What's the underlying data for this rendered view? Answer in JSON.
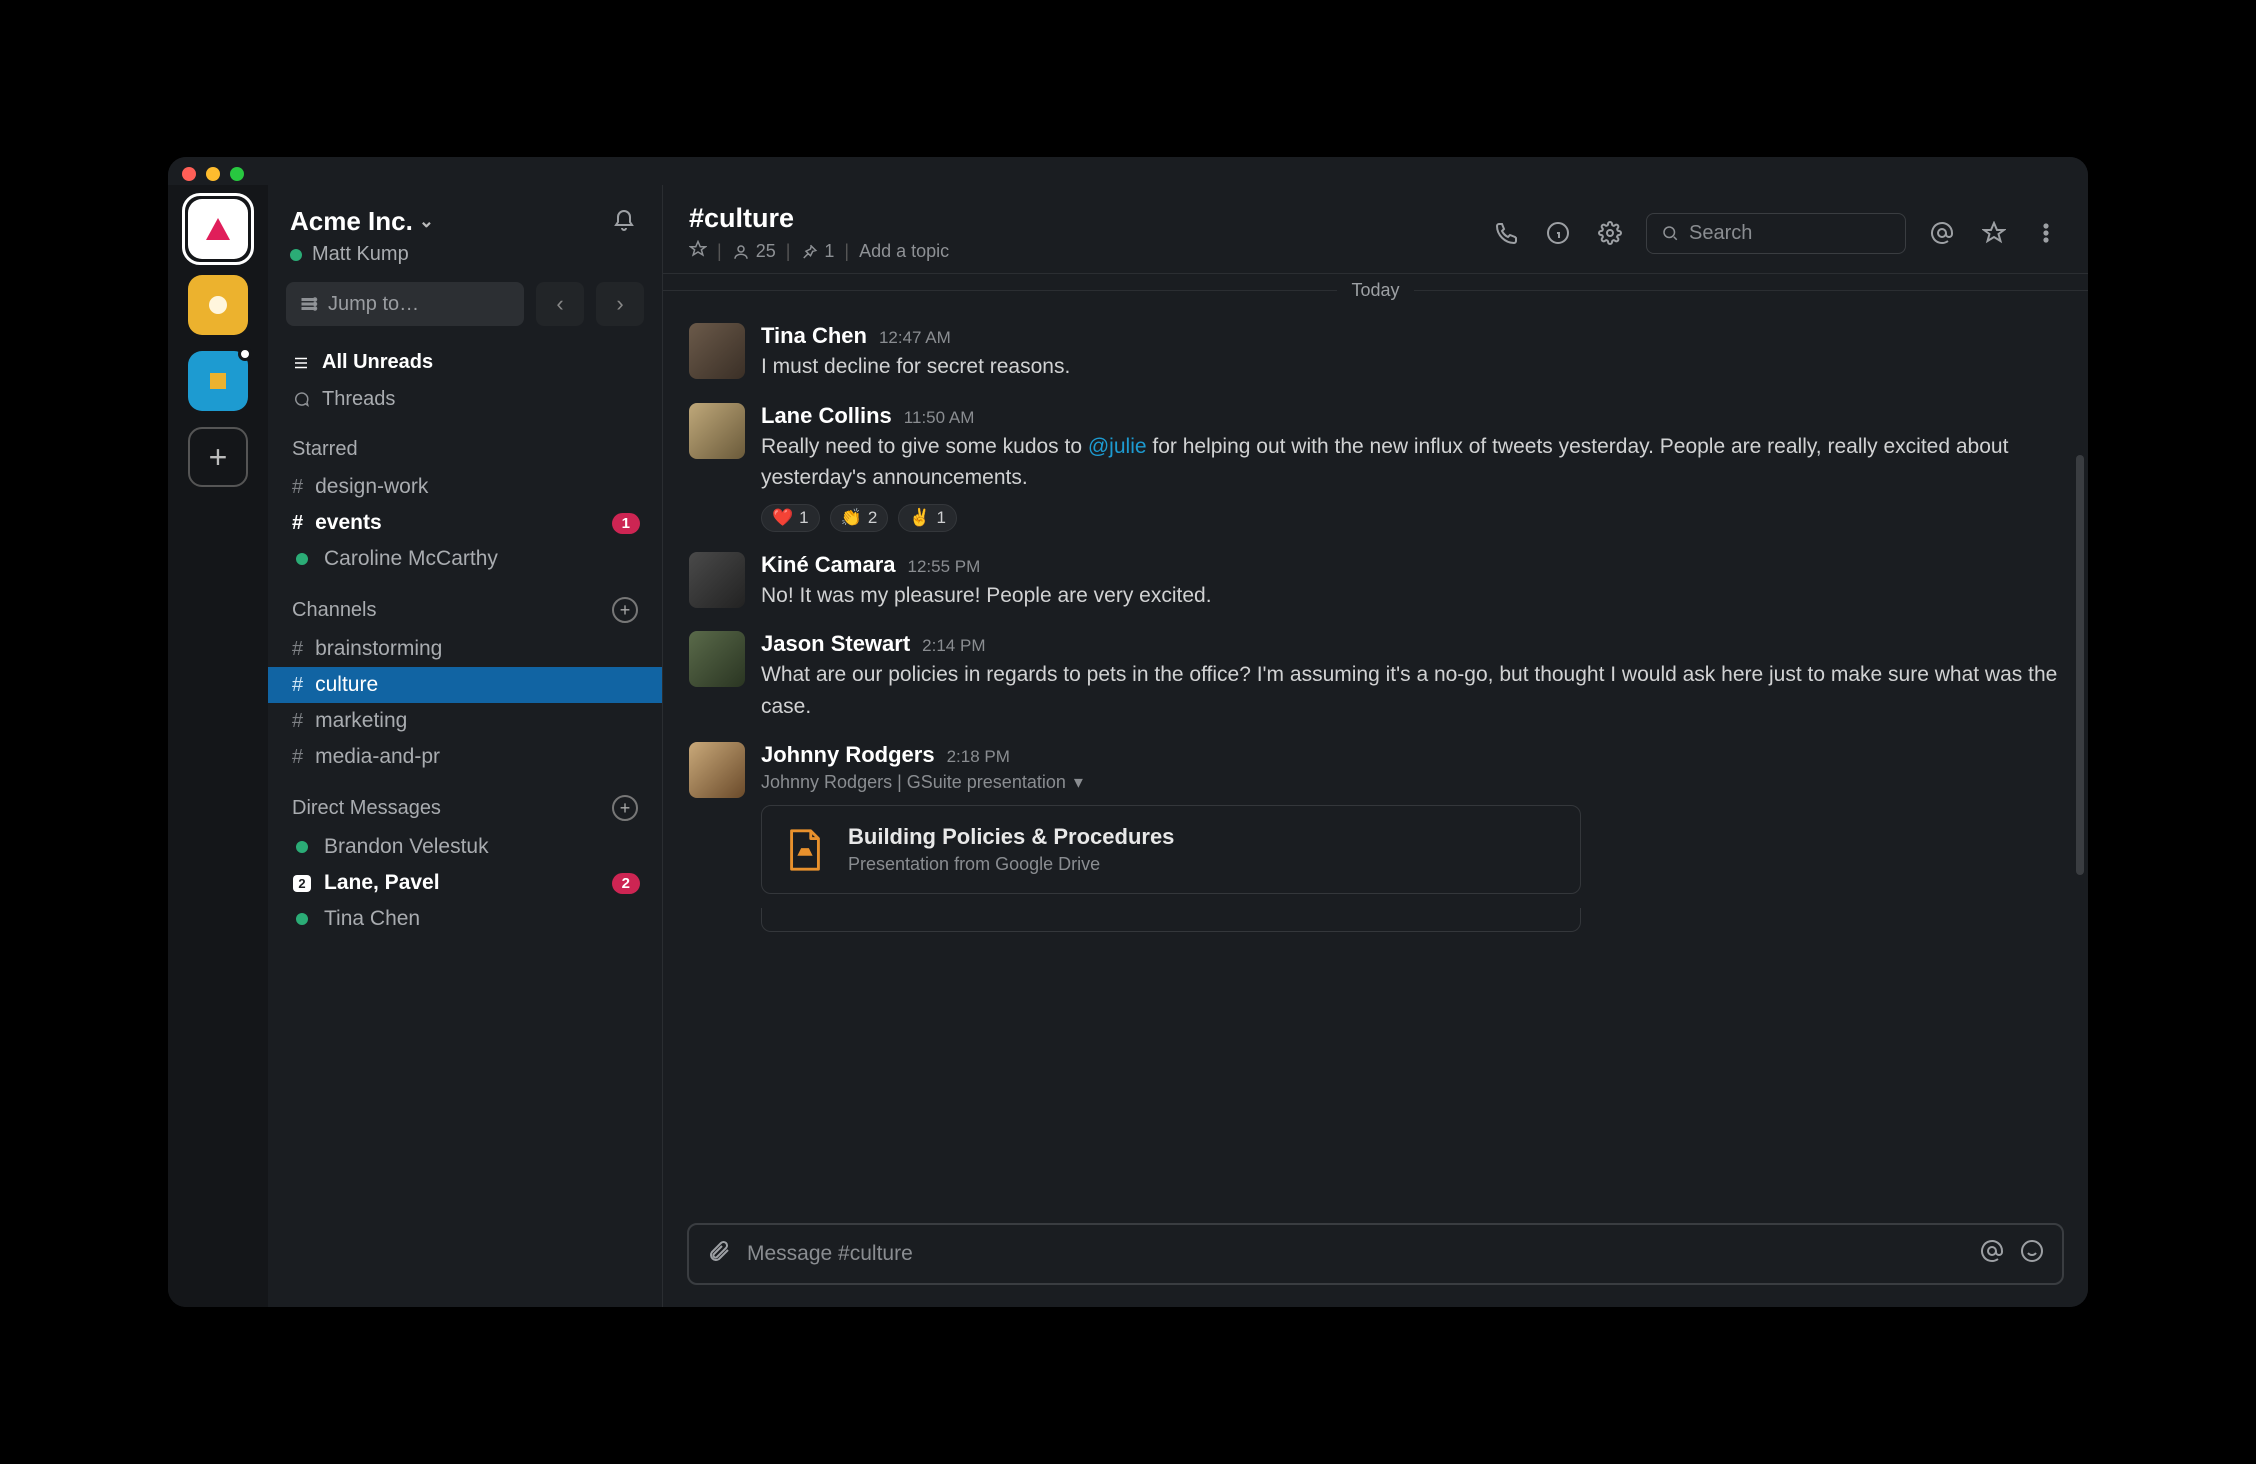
{
  "workspace": {
    "name": "Acme Inc.",
    "user": "Matt Kump"
  },
  "sidebar": {
    "jump_placeholder": "Jump to…",
    "all_unreads": "All Unreads",
    "threads": "Threads",
    "sections": {
      "starred": {
        "title": "Starred",
        "items": [
          {
            "kind": "channel",
            "label": "design-work",
            "bold": false
          },
          {
            "kind": "channel",
            "label": "events",
            "bold": true,
            "badge": "1"
          },
          {
            "kind": "dm",
            "label": "Caroline McCarthy",
            "presence": "active"
          }
        ]
      },
      "channels": {
        "title": "Channels",
        "items": [
          {
            "label": "brainstorming"
          },
          {
            "label": "culture",
            "active": true
          },
          {
            "label": "marketing"
          },
          {
            "label": "media-and-pr"
          }
        ]
      },
      "dms": {
        "title": "Direct Messages",
        "items": [
          {
            "label": "Brandon Velestuk",
            "presence": "active"
          },
          {
            "label": "Lane, Pavel",
            "multi": "2",
            "bold": true,
            "badge": "2"
          },
          {
            "label": "Tina Chen",
            "presence": "active"
          }
        ]
      }
    }
  },
  "channel": {
    "title": "#culture",
    "members": "25",
    "pins": "1",
    "topic_cta": "Add a topic",
    "search_placeholder": "Search",
    "date_divider": "Today",
    "composer_placeholder": "Message #culture"
  },
  "messages": [
    {
      "user": "Tina Chen",
      "time": "12:47 AM",
      "text": "I must decline for secret reasons.",
      "avatar": "#6b5a4a"
    },
    {
      "user": "Lane Collins",
      "time": "11:50 AM",
      "text_pre": "Really need to give some kudos to ",
      "mention": "@julie",
      "text_post": " for helping out with the new influx of tweets yesterday. People are really, really excited about yesterday's announcements.",
      "avatar": "#8a7a5a",
      "reactions": [
        {
          "emoji": "❤️",
          "count": "1"
        },
        {
          "emoji": "👏",
          "count": "2"
        },
        {
          "emoji": "✌️",
          "count": "1"
        }
      ]
    },
    {
      "user": "Kiné Camara",
      "time": "12:55 PM",
      "text": "No! It was my pleasure! People are very excited.",
      "avatar": "#3a3a3a"
    },
    {
      "user": "Jason Stewart",
      "time": "2:14 PM",
      "text": "What are our policies in regards to pets in the office? I'm assuming it's a no-go, but thought I would ask here just to make sure what was the case.",
      "avatar": "#4a5a3a"
    },
    {
      "user": "Johnny Rodgers",
      "time": "2:18 PM",
      "avatar": "#7a6a4a",
      "attachment": {
        "meta": "Johnny Rodgers | GSuite presentation",
        "title": "Building Policies & Procedures",
        "subtitle": "Presentation from Google Drive"
      }
    }
  ]
}
